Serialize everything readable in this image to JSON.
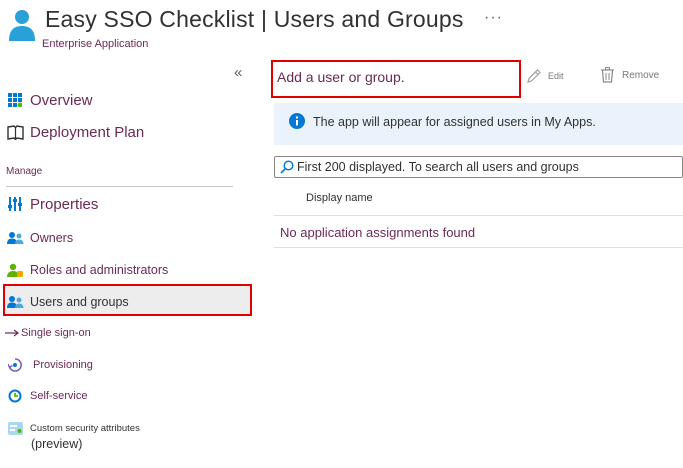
{
  "header": {
    "title": "Easy SSO Checklist | Users and Groups",
    "subtitle": "Enterprise Application",
    "more": "···"
  },
  "sidebar": {
    "collapse_glyph": "«",
    "section_label": "Manage",
    "items": [
      {
        "label": "Overview",
        "icon": "grid-icon"
      },
      {
        "label": "Deployment Plan",
        "icon": "book-icon"
      },
      {
        "label": "Properties",
        "icon": "properties-icon"
      },
      {
        "label": "Owners",
        "icon": "users-icon"
      },
      {
        "label": "Roles and administrators",
        "icon": "roles-icon"
      },
      {
        "label": "Users and groups",
        "icon": "users-icon",
        "selected": true
      },
      {
        "label": "Single sign-on",
        "icon": "arrow-right-icon"
      },
      {
        "label": "Provisioning",
        "icon": "provisioning-icon"
      },
      {
        "label": "Self-service",
        "icon": "self-service-icon"
      },
      {
        "label": "Custom security attributes",
        "icon": "security-attributes-icon"
      }
    ],
    "preview_label": "(preview)"
  },
  "toolbar": {
    "add_label": "Add a user or group.",
    "edit_label": "Edit",
    "remove_label": "Remove"
  },
  "info": {
    "text": "The app will appear for assigned users in My Apps."
  },
  "search": {
    "text": "First 200 displayed. To search all users and groups"
  },
  "table": {
    "columns": [
      "Display name"
    ],
    "empty_text": "No application assignments found"
  },
  "colors": {
    "accent": "#6b2a55",
    "highlight": "#e00000",
    "info_bg": "#eaf3fb",
    "info_icon": "#0078d4"
  }
}
